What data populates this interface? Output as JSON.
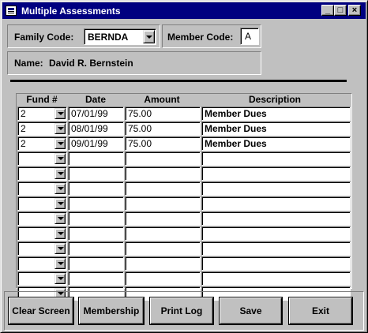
{
  "window": {
    "title": "Multiple Assessments",
    "icon": "form-icon",
    "controls": {
      "minimize": "_",
      "maximize": "□",
      "close": "×"
    }
  },
  "header": {
    "family_code_label": "Family Code:",
    "family_code_value": "BERNDA",
    "member_code_label": "Member Code:",
    "member_code_value": "A",
    "name_label": "Name:",
    "name_value": "David R. Bernstein"
  },
  "grid": {
    "columns": [
      "Fund #",
      "Date",
      "Amount",
      "Description"
    ],
    "rows": [
      {
        "fund": "2",
        "date": "07/01/99",
        "amount": "75.00",
        "description": "Member Dues"
      },
      {
        "fund": "2",
        "date": "08/01/99",
        "amount": "75.00",
        "description": "Member Dues"
      },
      {
        "fund": "2",
        "date": "09/01/99",
        "amount": "75.00",
        "description": "Member Dues"
      },
      {
        "fund": "",
        "date": "",
        "amount": "",
        "description": ""
      },
      {
        "fund": "",
        "date": "",
        "amount": "",
        "description": ""
      },
      {
        "fund": "",
        "date": "",
        "amount": "",
        "description": ""
      },
      {
        "fund": "",
        "date": "",
        "amount": "",
        "description": ""
      },
      {
        "fund": "",
        "date": "",
        "amount": "",
        "description": ""
      },
      {
        "fund": "",
        "date": "",
        "amount": "",
        "description": ""
      },
      {
        "fund": "",
        "date": "",
        "amount": "",
        "description": ""
      },
      {
        "fund": "",
        "date": "",
        "amount": "",
        "description": ""
      },
      {
        "fund": "",
        "date": "",
        "amount": "",
        "description": ""
      },
      {
        "fund": "",
        "date": "",
        "amount": "",
        "description": ""
      }
    ]
  },
  "buttons": {
    "clear_screen": "Clear Screen",
    "membership": "Membership",
    "print_log": "Print Log",
    "save": "Save",
    "exit": "Exit"
  }
}
